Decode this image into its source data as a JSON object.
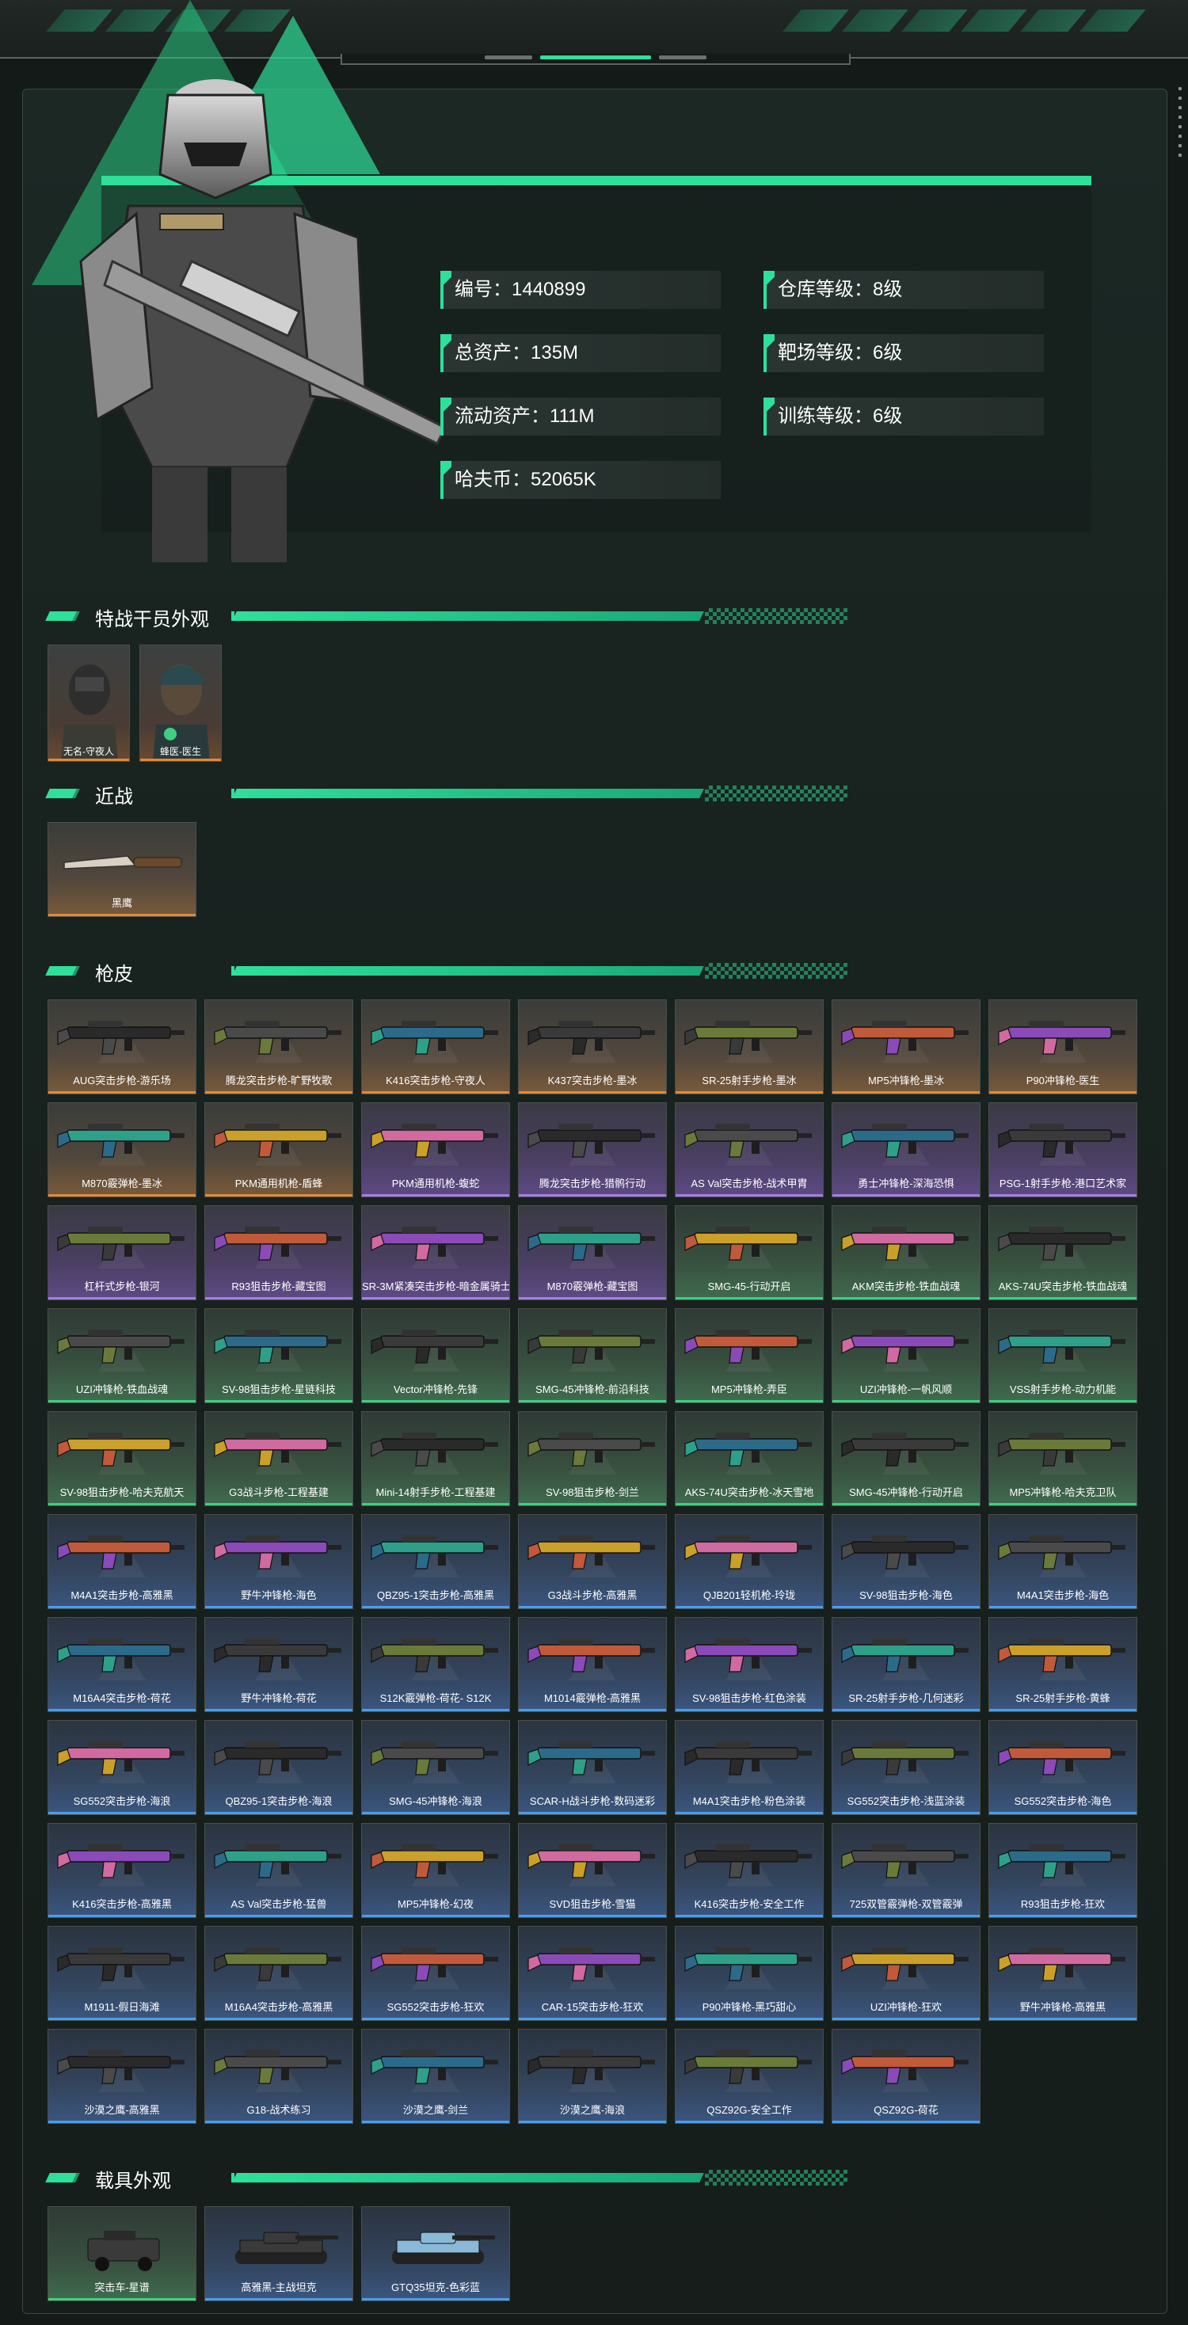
{
  "profile": {
    "id": "编号：1440899",
    "total_assets": "总资产：135M",
    "liquid_assets": "流动资产：111M",
    "havoc_coins": "哈夫币：52065K",
    "warehouse_level": "仓库等级：8级",
    "range_level": "靶场等级：6级",
    "training_level": "训练等级：6级"
  },
  "sections": {
    "operators": "特战干员外观",
    "melee": "近战",
    "gun_skins": "枪皮",
    "vehicles": "载具外观"
  },
  "operators": [
    {
      "label": "无名-守夜人"
    },
    {
      "label": "蜂医-医生"
    }
  ],
  "melee": [
    {
      "label": "黑鹰"
    }
  ],
  "guns": [
    {
      "label": "AUG突击步枪-游乐场",
      "rarity": "orange"
    },
    {
      "label": "腾龙突击步枪-旷野牧歌",
      "rarity": "orange"
    },
    {
      "label": "K416突击步枪-守夜人",
      "rarity": "orange"
    },
    {
      "label": "K437突击步枪-墨冰",
      "rarity": "orange"
    },
    {
      "label": "SR-25射手步枪-墨冰",
      "rarity": "orange"
    },
    {
      "label": "MP5冲锋枪-墨冰",
      "rarity": "orange"
    },
    {
      "label": "P90冲锋枪-医生",
      "rarity": "orange"
    },
    {
      "label": "M870霰弹枪-墨冰",
      "rarity": "orange"
    },
    {
      "label": "PKM通用机枪-盾蜂",
      "rarity": "orange"
    },
    {
      "label": "PKM通用机枪-蝮蛇",
      "rarity": "purple"
    },
    {
      "label": "腾龙突击步枪-猎鹘行动",
      "rarity": "purple"
    },
    {
      "label": "AS Val突击步枪-战术甲胄",
      "rarity": "purple"
    },
    {
      "label": "勇士冲锋枪-深海恐惧",
      "rarity": "purple"
    },
    {
      "label": "PSG-1射手步枪-港口艺术家",
      "rarity": "purple"
    },
    {
      "label": "杠杆式步枪-银河",
      "rarity": "purple"
    },
    {
      "label": "R93狙击步枪-藏宝图",
      "rarity": "purple"
    },
    {
      "label": "SR-3M紧凑突击步枪-暗金属骑士",
      "rarity": "purple"
    },
    {
      "label": "M870霰弹枪-藏宝图",
      "rarity": "purple"
    },
    {
      "label": "SMG-45-行动开启",
      "rarity": "green"
    },
    {
      "label": "AKM突击步枪-铁血战魂",
      "rarity": "green"
    },
    {
      "label": "AKS-74U突击步枪-铁血战魂",
      "rarity": "green"
    },
    {
      "label": "UZI冲锋枪-铁血战魂",
      "rarity": "green"
    },
    {
      "label": "SV-98狙击步枪-星链科技",
      "rarity": "green"
    },
    {
      "label": "Vector冲锋枪-先锋",
      "rarity": "green"
    },
    {
      "label": "SMG-45冲锋枪-前沿科技",
      "rarity": "green"
    },
    {
      "label": "MP5冲锋枪-弄臣",
      "rarity": "green"
    },
    {
      "label": "UZI冲锋枪-一帆风顺",
      "rarity": "green"
    },
    {
      "label": "VSS射手步枪-动力机能",
      "rarity": "green"
    },
    {
      "label": "SV-98狙击步枪-哈夫克航天",
      "rarity": "green"
    },
    {
      "label": "G3战斗步枪-工程基建",
      "rarity": "green"
    },
    {
      "label": "Mini-14射手步枪-工程基建",
      "rarity": "green"
    },
    {
      "label": "SV-98狙击步枪-剑兰",
      "rarity": "green"
    },
    {
      "label": "AKS-74U突击步枪-冰天雪地",
      "rarity": "green"
    },
    {
      "label": "SMG-45冲锋枪-行动开启",
      "rarity": "green"
    },
    {
      "label": "MP5冲锋枪-哈夫克卫队",
      "rarity": "green"
    },
    {
      "label": "M4A1突击步枪-高雅黑",
      "rarity": "blue"
    },
    {
      "label": "野牛冲锋枪-海色",
      "rarity": "blue"
    },
    {
      "label": "QBZ95-1突击步枪-高雅黑",
      "rarity": "blue"
    },
    {
      "label": "G3战斗步枪-高雅黑",
      "rarity": "blue"
    },
    {
      "label": "QJB201轻机枪-玲珑",
      "rarity": "blue"
    },
    {
      "label": "SV-98狙击步枪-海色",
      "rarity": "blue"
    },
    {
      "label": "M4A1突击步枪-海色",
      "rarity": "blue"
    },
    {
      "label": "M16A4突击步枪-荷花",
      "rarity": "blue"
    },
    {
      "label": "野牛冲锋枪-荷花",
      "rarity": "blue"
    },
    {
      "label": "S12K霰弹枪-荷花- S12K",
      "rarity": "blue"
    },
    {
      "label": "M1014霰弹枪-高雅黑",
      "rarity": "blue"
    },
    {
      "label": "SV-98狙击步枪-红色涂装",
      "rarity": "blue"
    },
    {
      "label": "SR-25射手步枪-几何迷彩",
      "rarity": "blue"
    },
    {
      "label": "SR-25射手步枪-黄蜂",
      "rarity": "blue"
    },
    {
      "label": "SG552突击步枪-海浪",
      "rarity": "blue"
    },
    {
      "label": "QBZ95-1突击步枪-海浪",
      "rarity": "blue"
    },
    {
      "label": "SMG-45冲锋枪-海浪",
      "rarity": "blue"
    },
    {
      "label": "SCAR-H战斗步枪-数码迷彩",
      "rarity": "blue"
    },
    {
      "label": "M4A1突击步枪-粉色涂装",
      "rarity": "blue"
    },
    {
      "label": "SG552突击步枪-浅蓝涂装",
      "rarity": "blue"
    },
    {
      "label": "SG552突击步枪-海色",
      "rarity": "blue"
    },
    {
      "label": "K416突击步枪-高雅黑",
      "rarity": "blue"
    },
    {
      "label": "AS Val突击步枪-猛兽",
      "rarity": "blue"
    },
    {
      "label": "MP5冲锋枪-幻夜",
      "rarity": "blue"
    },
    {
      "label": "SVD狙击步枪-雪猫",
      "rarity": "blue"
    },
    {
      "label": "K416突击步枪-安全工作",
      "rarity": "blue"
    },
    {
      "label": "725双管霰弹枪-双管霰弹",
      "rarity": "blue"
    },
    {
      "label": "R93狙击步枪-狂欢",
      "rarity": "blue"
    },
    {
      "label": "M1911-假日海滩",
      "rarity": "blue"
    },
    {
      "label": "M16A4突击步枪-高雅黑",
      "rarity": "blue"
    },
    {
      "label": "SG552突击步枪-狂欢",
      "rarity": "blue"
    },
    {
      "label": "CAR-15突击步枪-狂欢",
      "rarity": "blue"
    },
    {
      "label": "P90冲锋枪-黑巧甜心",
      "rarity": "blue"
    },
    {
      "label": "UZI冲锋枪-狂欢",
      "rarity": "blue"
    },
    {
      "label": "野牛冲锋枪-高雅黑",
      "rarity": "blue"
    },
    {
      "label": "沙漠之鹰-高雅黑",
      "rarity": "blue"
    },
    {
      "label": "G18-战术练习",
      "rarity": "blue"
    },
    {
      "label": "沙漠之鹰-剑兰",
      "rarity": "blue"
    },
    {
      "label": "沙漠之鹰-海浪",
      "rarity": "blue"
    },
    {
      "label": "QSZ92G-安全工作",
      "rarity": "blue"
    },
    {
      "label": "QSZ92G-荷花",
      "rarity": "blue"
    }
  ],
  "vehicles": [
    {
      "label": "突击车-星谱",
      "rarity": "green"
    },
    {
      "label": "高雅黑-主战坦克",
      "rarity": "blue"
    },
    {
      "label": "GTQ35坦克-色彩蓝",
      "rarity": "blue"
    }
  ],
  "colors": {
    "accent": "#2ee09a",
    "orange": "#e08a3a",
    "purple": "#a57ee0",
    "green": "#3fcf7f",
    "blue": "#4a9ee8"
  }
}
